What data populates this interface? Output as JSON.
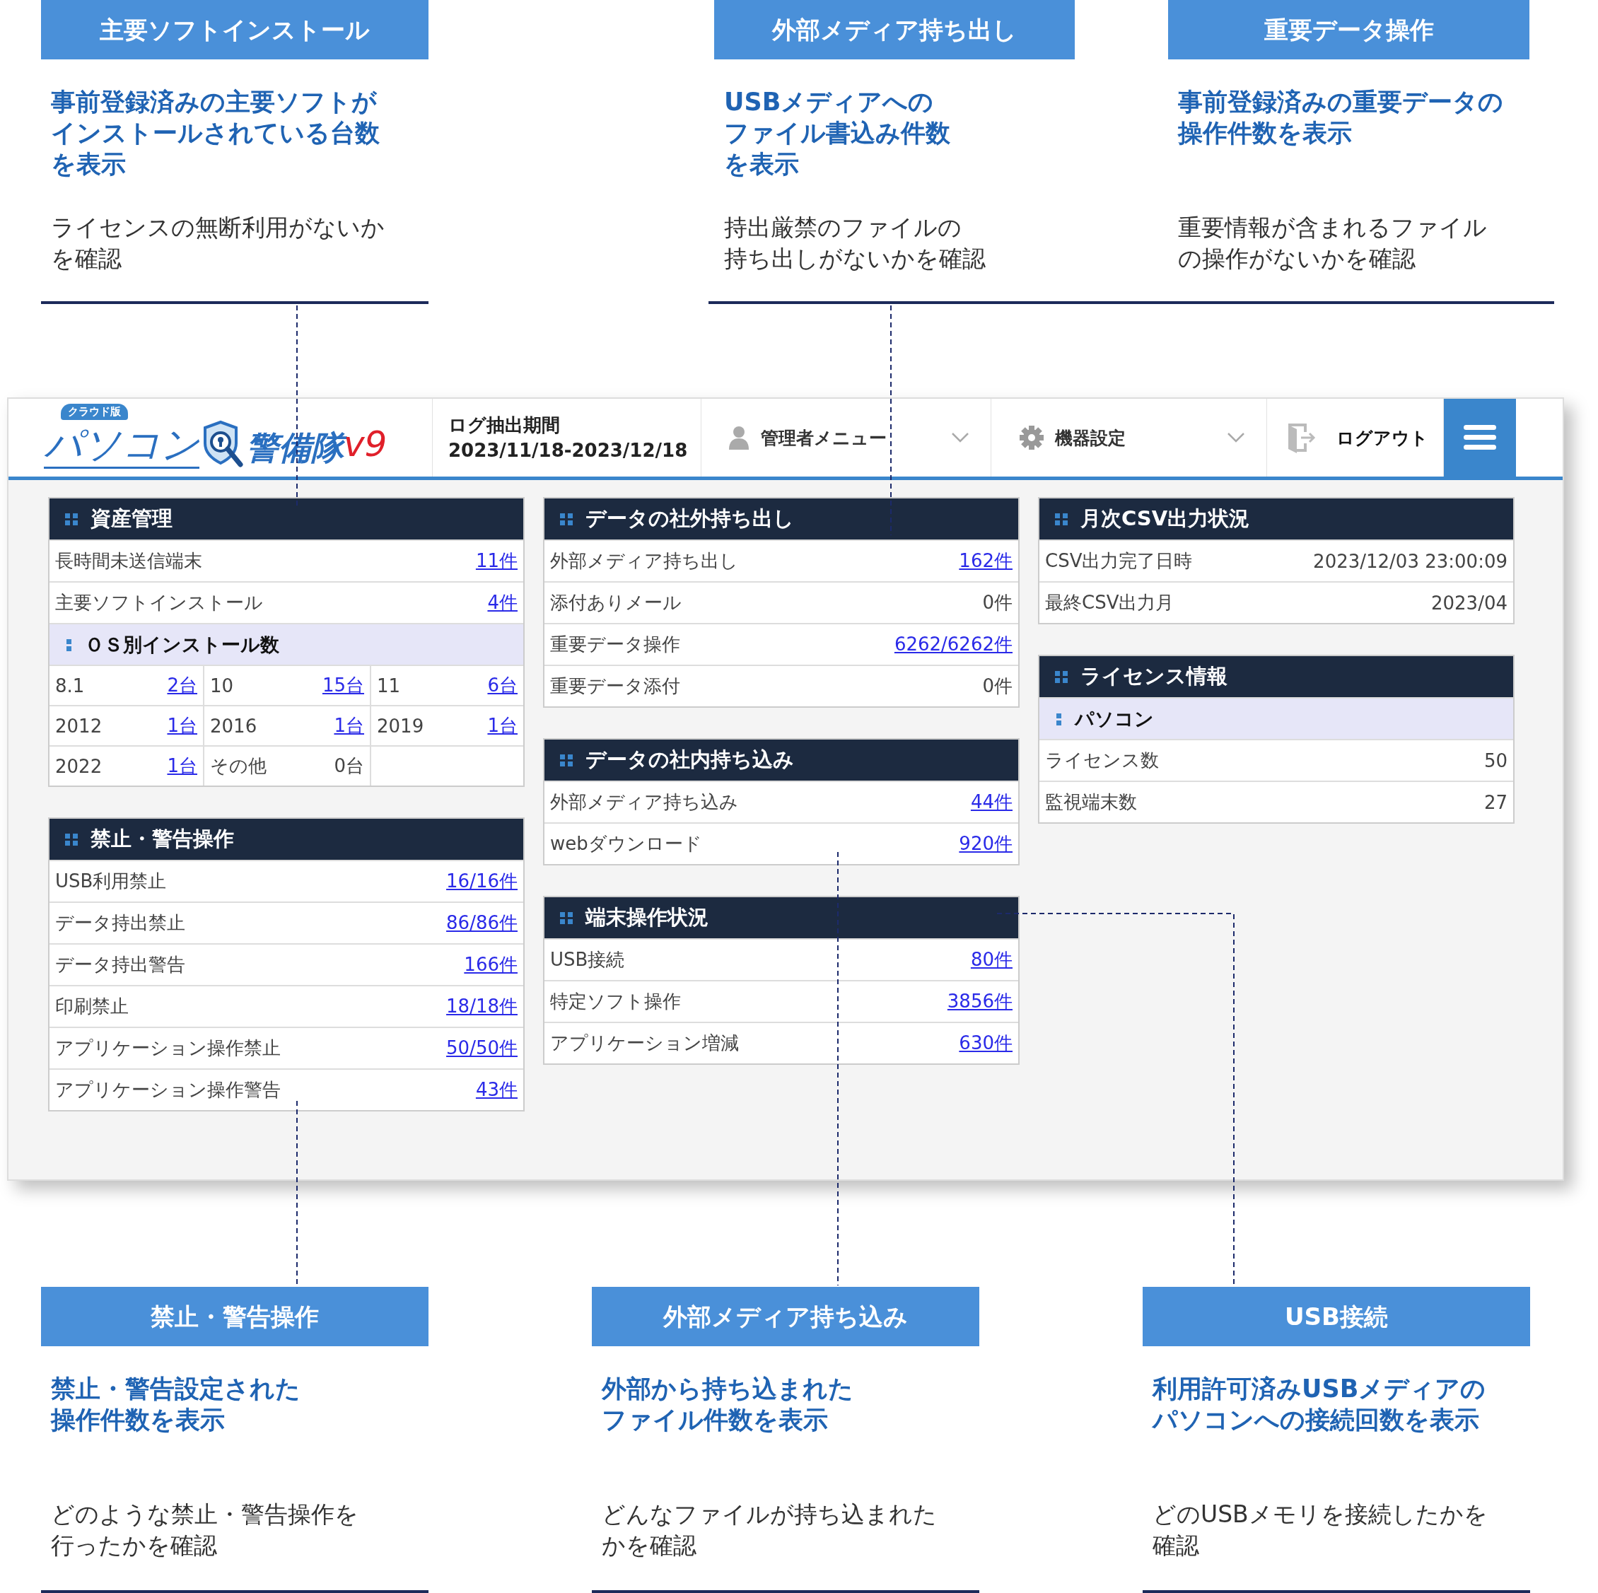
{
  "top_callouts": [
    {
      "title": "主要ソフトインストール",
      "summary": [
        "事前登録済みの主要ソフトが",
        "インストールされている台数",
        "を表示"
      ],
      "detail": [
        "ライセンスの無断利用がないか",
        "を確認"
      ]
    },
    {
      "title": "外部メディア持ち出し",
      "summary": [
        "USBメディアへの",
        "ファイル書込み件数",
        "を表示"
      ],
      "detail": [
        "持出厳禁のファイルの",
        "持ち出しがないかを確認"
      ]
    },
    {
      "title": "重要データ操作",
      "summary": [
        "事前登録済みの重要データの",
        "操作件数を表示"
      ],
      "detail": [
        "重要情報が含まれるファイル",
        "の操作がないかを確認"
      ]
    }
  ],
  "header": {
    "logo": {
      "badge": "クラウド版",
      "name_1": "パソコン",
      "name_2": "警備隊",
      "version": "v9"
    },
    "period_label": "ログ抽出期間",
    "period": "2023/11/18-2023/12/18",
    "menus": [
      {
        "kind": "user-menu",
        "label": "管理者メニュー"
      },
      {
        "kind": "settings-menu",
        "label": "機器設定"
      },
      {
        "kind": "logout",
        "label": "ログアウト"
      }
    ]
  },
  "columns": [
    [
      {
        "title": "資産管理",
        "items": [
          {
            "kind": "row",
            "label": "長時間未送信端末",
            "value": "11件",
            "link": true
          },
          {
            "kind": "row",
            "label": "主要ソフトインストール",
            "value": "4件",
            "link": true
          },
          {
            "kind": "subheader",
            "label": "ＯＳ別インストール数"
          },
          {
            "kind": "grid",
            "cells": [
              {
                "label": "8.1",
                "value": "2台",
                "link": true
              },
              {
                "label": "10",
                "value": "15台",
                "link": true
              },
              {
                "label": "11",
                "value": "6台",
                "link": true
              },
              {
                "label": "2012",
                "value": "1台",
                "link": true
              },
              {
                "label": "2016",
                "value": "1台",
                "link": true
              },
              {
                "label": "2019",
                "value": "1台",
                "link": true
              },
              {
                "label": "2022",
                "value": "1台",
                "link": true
              },
              {
                "label": "その他",
                "value": "0台",
                "link": false
              }
            ]
          }
        ]
      },
      {
        "title": "禁止・警告操作",
        "items": [
          {
            "kind": "row",
            "label": "USB利用禁止",
            "value": "16/16件",
            "link": true
          },
          {
            "kind": "row",
            "label": "データ持出禁止",
            "value": "86/86件",
            "link": true
          },
          {
            "kind": "row",
            "label": "データ持出警告",
            "value": "166件",
            "link": true
          },
          {
            "kind": "row",
            "label": "印刷禁止",
            "value": "18/18件",
            "link": true
          },
          {
            "kind": "row",
            "label": "アプリケーション操作禁止",
            "value": "50/50件",
            "link": true
          },
          {
            "kind": "row",
            "label": "アプリケーション操作警告",
            "value": "43件",
            "link": true
          }
        ]
      }
    ],
    [
      {
        "title": "データの社外持ち出し",
        "items": [
          {
            "kind": "row",
            "label": "外部メディア持ち出し",
            "value": "162件",
            "link": true
          },
          {
            "kind": "row",
            "label": "添付ありメール",
            "value": "0件",
            "link": false
          },
          {
            "kind": "row",
            "label": "重要データ操作",
            "value": "6262/6262件",
            "link": true
          },
          {
            "kind": "row",
            "label": "重要データ添付",
            "value": "0件",
            "link": false
          }
        ]
      },
      {
        "title": "データの社内持ち込み",
        "items": [
          {
            "kind": "row",
            "label": "外部メディア持ち込み",
            "value": "44件",
            "link": true
          },
          {
            "kind": "row",
            "label": "webダウンロード",
            "value": "920件",
            "link": true
          }
        ]
      },
      {
        "title": "端末操作状況",
        "items": [
          {
            "kind": "row",
            "label": "USB接続",
            "value": "80件",
            "link": true
          },
          {
            "kind": "row",
            "label": "特定ソフト操作",
            "value": "3856件",
            "link": true
          },
          {
            "kind": "row",
            "label": "アプリケーション増減",
            "value": "630件",
            "link": true
          }
        ]
      }
    ],
    [
      {
        "title": "月次CSV出力状況",
        "items": [
          {
            "kind": "row",
            "label": "CSV出力完了日時",
            "value": "2023/12/03 23:00:09",
            "link": false
          },
          {
            "kind": "row",
            "label": "最終CSV出力月",
            "value": "2023/04",
            "link": false
          }
        ]
      },
      {
        "title": "ライセンス情報",
        "items": [
          {
            "kind": "subheader",
            "label": "パソコン"
          },
          {
            "kind": "row",
            "label": "ライセンス数",
            "value": "50",
            "link": false
          },
          {
            "kind": "row",
            "label": "監視端末数",
            "value": "27",
            "link": false
          }
        ]
      }
    ]
  ],
  "bottom_callouts": [
    {
      "title": "禁止・警告操作",
      "summary": [
        "禁止・警告設定された",
        "操作件数を表示"
      ],
      "detail": [
        "どのような禁止・警告操作を",
        "行ったかを確認"
      ]
    },
    {
      "title": "外部メディア持ち込み",
      "summary": [
        "外部から持ち込まれた",
        "ファイル件数を表示"
      ],
      "detail": [
        "どんなファイルが持ち込まれた",
        "かを確認"
      ]
    },
    {
      "title": "USB接続",
      "summary": [
        "利用許可済みUSBメディアの",
        "パソコンへの接続回数を表示"
      ],
      "detail": [
        "どのUSBメモリを接続したかを",
        "確認"
      ]
    }
  ]
}
